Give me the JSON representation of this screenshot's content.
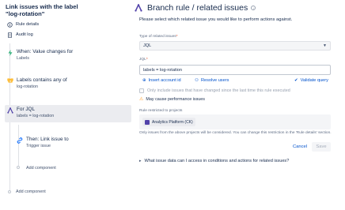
{
  "sidebar": {
    "rule_title": "Link issues with the label \"log-rotation\"",
    "nav": [
      {
        "label": "Rule details"
      },
      {
        "label": "Audit log"
      }
    ],
    "steps": [
      {
        "title": "When: Value changes for",
        "subtitle": "Labels",
        "icon": "bolt-icon",
        "color": "#36b37e"
      },
      {
        "title": "Labels contains any of",
        "subtitle": "log-rotation",
        "icon": "condition-icon",
        "color": "#ffab00"
      },
      {
        "title": "For JQL",
        "subtitle": "labels = log-rotation",
        "icon": "branch-icon",
        "color": "#5243aa"
      },
      {
        "title": "Then: Link issue to",
        "subtitle": "Trigger issue",
        "icon": "link-icon",
        "color": "#0065ff"
      }
    ],
    "add_component_inner": "Add component",
    "add_component_outer": "Add component"
  },
  "main": {
    "header": "Branch rule / related issues",
    "description": "Please select which related issue you would like to perform actions against.",
    "type_label": "Type of related issues",
    "type_value": "JQL",
    "jql_label": "JQL",
    "jql_value": "labels = log-rotation",
    "insert_account": "Insert account id",
    "resolve_users": "Resolve users",
    "validate_query": "Validate query",
    "checkbox_label": "Only include issues that have changed since the last time this rule executed",
    "warning": "May cause performance issues",
    "restricted_label": "Rule restricted to projects",
    "project_tag": "Analytics Platform (CK)",
    "hint": "Only issues from the above projects will be considered. You can change this restriction in the 'Rule details' section.",
    "cancel": "Cancel",
    "save": "Save",
    "faq": "What issue data can I access in conditions and actions for related issues?"
  }
}
